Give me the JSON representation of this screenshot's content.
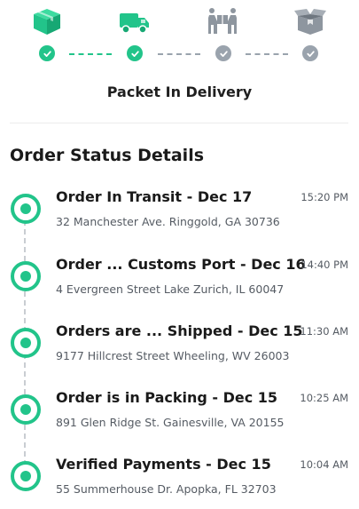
{
  "colors": {
    "accent": "#22c48a",
    "inactive": "#9aa3ad",
    "text": "#1a1a1a",
    "muted": "#555b63"
  },
  "steps": [
    {
      "icon": "box-icon",
      "state": "done"
    },
    {
      "icon": "truck-icon",
      "state": "done"
    },
    {
      "icon": "people-carry-icon",
      "state": "pending"
    },
    {
      "icon": "open-box-icon",
      "state": "pending"
    }
  ],
  "status_title": "Packet In Delivery",
  "section_title": "Order Status Details",
  "events": [
    {
      "title": "Order In Transit - Dec 17",
      "address": "32 Manchester Ave. Ringgold, GA 30736",
      "time": "15:20 PM"
    },
    {
      "title": "Order ... Customs Port - Dec 16",
      "address": "4 Evergreen Street Lake Zurich, IL 60047",
      "time": "14:40 PM"
    },
    {
      "title": "Orders are ... Shipped - Dec 15",
      "address": "9177 Hillcrest Street Wheeling, WV 26003",
      "time": "11:30 AM"
    },
    {
      "title": "Order is in Packing - Dec 15",
      "address": "891 Glen Ridge St. Gainesville, VA 20155",
      "time": "10:25 AM"
    },
    {
      "title": "Verified Payments - Dec 15",
      "address": "55 Summerhouse Dr. Apopka, FL 32703",
      "time": "10:04 AM"
    }
  ]
}
